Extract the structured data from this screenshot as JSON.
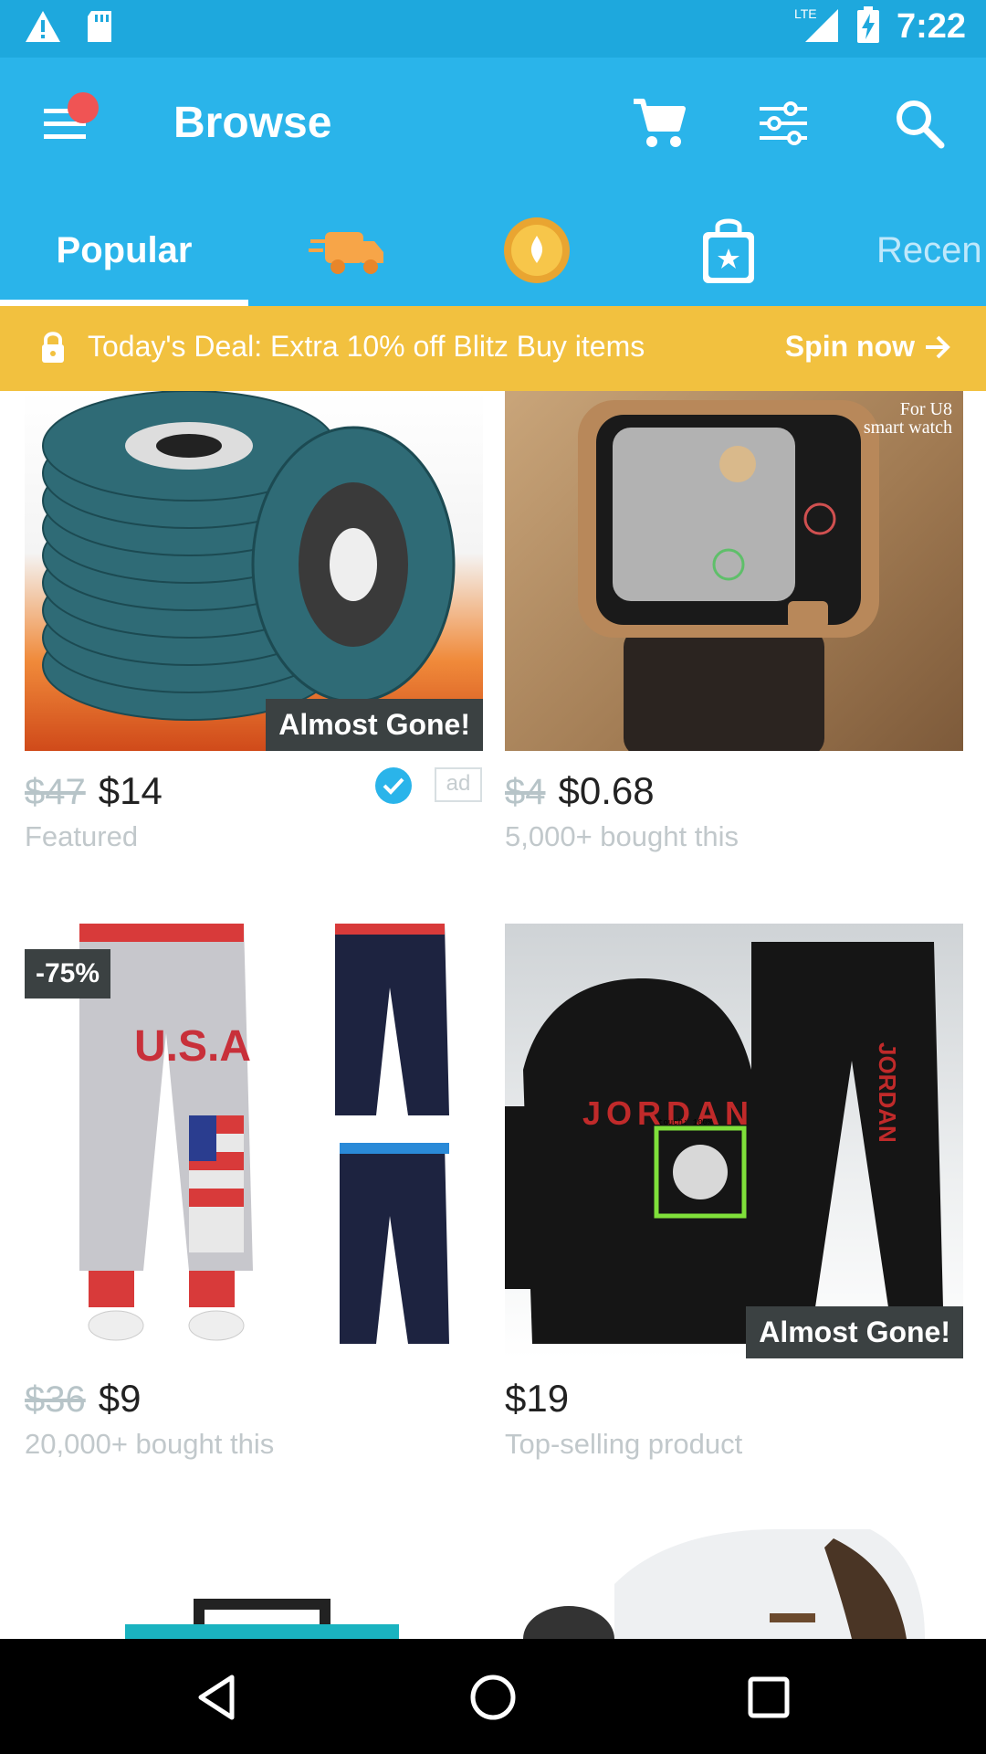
{
  "status_bar": {
    "network": "LTE",
    "time": "7:22",
    "icons": [
      "warning-icon",
      "sd-card-icon",
      "signal-icon",
      "battery-charging-icon"
    ]
  },
  "app_bar": {
    "title": "Browse",
    "icons": [
      "menu-icon",
      "notification-dot",
      "cart-icon",
      "filter-icon",
      "search-icon"
    ]
  },
  "tabs": [
    {
      "label": "Popular",
      "selected": true
    },
    {
      "label": "",
      "icon": "delivery-truck-icon"
    },
    {
      "label": "",
      "icon": "coin-icon"
    },
    {
      "label": "",
      "icon": "shopping-bag-star-icon"
    },
    {
      "label": "Recen"
    }
  ],
  "deal": {
    "text": "Today's Deal: Extra 10% off Blitz Buy items",
    "action": "Spin now"
  },
  "products": [
    {
      "image": "flap-discs",
      "tag": "Almost Gone!",
      "old_price": "$47",
      "price": "$14",
      "subtitle": "Featured",
      "verified": true,
      "ad_label": "ad"
    },
    {
      "image": "smart-watch",
      "image_text": "For U8\nsmart watch",
      "old_price": "$4",
      "price": "$0.68",
      "subtitle": "5,000+ bought this"
    },
    {
      "image": "usa-pants",
      "discount": "-75%",
      "old_price": "$36",
      "price": "$9",
      "subtitle": "20,000+ bought this"
    },
    {
      "image": "jordan-tracksuit",
      "tag": "Almost Gone!",
      "overlay": "touch: 100%",
      "price": "$19",
      "subtitle": "Top-selling product"
    }
  ],
  "colors": {
    "status_bar": "#1ea8dd",
    "app_bar": "#2ab4ea",
    "deal_banner": "#f2c13f",
    "tag_bg": "#3b4142",
    "muted_text": "#c1c8cb"
  }
}
